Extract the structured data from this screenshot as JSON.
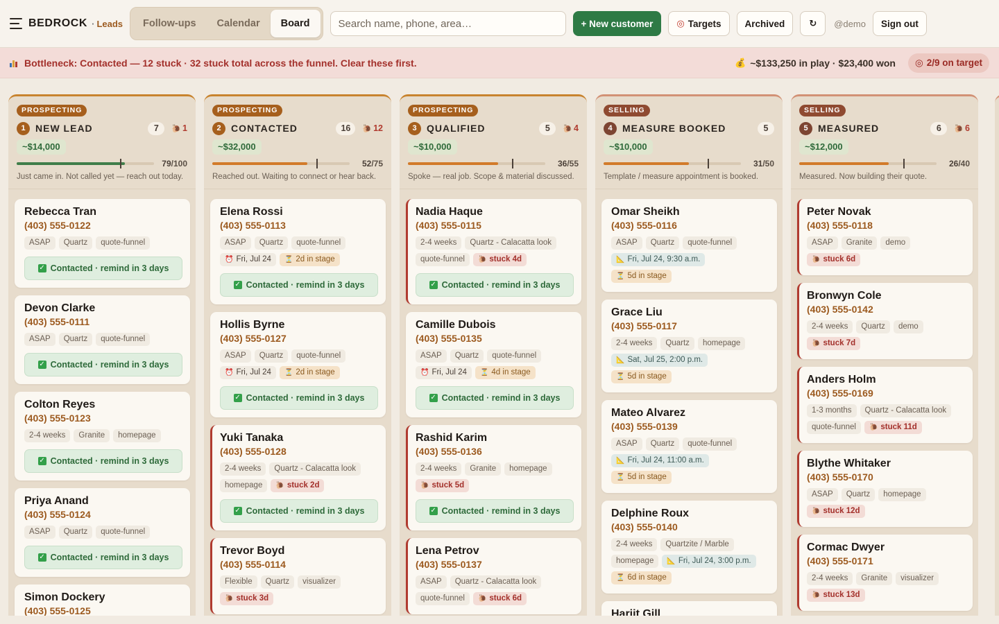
{
  "app": {
    "brand": "BEDROCK",
    "section": "Leads",
    "dot": "·"
  },
  "nav": {
    "tabs": [
      {
        "label": "Follow-ups"
      },
      {
        "label": "Calendar"
      },
      {
        "label": "Board"
      }
    ],
    "active": "Board"
  },
  "search": {
    "placeholder": "Search name, phone, area…",
    "value": ""
  },
  "actions": {
    "new_customer": "+ New customer",
    "targets": "Targets",
    "archived": "Archived",
    "refresh": "↻",
    "user": "@demo",
    "signout": "Sign out"
  },
  "alert": {
    "label": "Bottleneck:",
    "stage": "Contacted",
    "text": "— 12 stuck · 32 stuck total across the funnel. Clear these first.",
    "in_play": "~$133,250 in play · $23,400 won",
    "on_target": "2/9 on target"
  },
  "colors": {
    "accent": "#2e7a45",
    "stuck": "#b03b2f",
    "prospect": "#a65f1d",
    "selling": "#8f4a31"
  },
  "columns": [
    {
      "group": "PROSPECTING",
      "number": "1",
      "title": "NEW LEAD",
      "count": "7",
      "stuck": "1",
      "value": "~$14,000",
      "progress": "79",
      "target": "/100",
      "progress_fraction": 0.79,
      "target_mark": 0.75,
      "bar": "green",
      "desc": "Just came in. Not called yet — reach out today.",
      "cards": [
        {
          "name": "Rebecca Tran",
          "phone": "(403) 555-0122",
          "tags": [
            "ASAP",
            "Quartz",
            "quote-funnel"
          ],
          "action": "Contacted · remind in 3 days"
        },
        {
          "name": "Devon Clarke",
          "phone": "(403) 555-0111",
          "tags": [
            "ASAP",
            "Quartz",
            "quote-funnel"
          ],
          "action": "Contacted · remind in 3 days"
        },
        {
          "name": "Colton Reyes",
          "phone": "(403) 555-0123",
          "tags": [
            "2-4 weeks",
            "Granite",
            "homepage"
          ],
          "action": "Contacted · remind in 3 days"
        },
        {
          "name": "Priya Anand",
          "phone": "(403) 555-0124",
          "tags": [
            "ASAP",
            "Quartz",
            "quote-funnel"
          ],
          "action": "Contacted · remind in 3 days"
        },
        {
          "name": "Simon Dockery",
          "phone": "(403) 555-0125",
          "tags": []
        }
      ]
    },
    {
      "group": "PROSPECTING",
      "number": "2",
      "title": "CONTACTED",
      "count": "16",
      "stuck": "12",
      "value": "~$32,000",
      "progress": "52",
      "target": "/75",
      "progress_fraction": 0.693,
      "target_mark": 0.76,
      "bar": "orange",
      "desc": "Reached out. Waiting to connect or hear back.",
      "cards": [
        {
          "name": "Elena Rossi",
          "phone": "(403) 555-0113",
          "tags": [
            "ASAP",
            "Quartz",
            "quote-funnel"
          ],
          "due": "Fri, Jul 24",
          "instage": "2d in stage",
          "action": "Contacted · remind in 3 days"
        },
        {
          "name": "Hollis Byrne",
          "phone": "(403) 555-0127",
          "tags": [
            "ASAP",
            "Quartz",
            "quote-funnel"
          ],
          "due": "Fri, Jul 24",
          "instage": "2d in stage",
          "action": "Contacted · remind in 3 days"
        },
        {
          "name": "Yuki Tanaka",
          "phone": "(403) 555-0128",
          "tags": [
            "2-4 weeks",
            "Quartz - Calacatta look",
            "homepage"
          ],
          "stuck": "stuck 2d",
          "action": "Contacted · remind in 3 days"
        },
        {
          "name": "Trevor Boyd",
          "phone": "(403) 555-0114",
          "tags": [
            "Flexible",
            "Quartz",
            "visualizer"
          ],
          "stuck": "stuck 3d"
        }
      ]
    },
    {
      "group": "PROSPECTING",
      "number": "3",
      "title": "QUALIFIED",
      "count": "5",
      "stuck": "4",
      "value": "~$10,000",
      "progress": "36",
      "target": "/55",
      "progress_fraction": 0.655,
      "target_mark": 0.76,
      "bar": "orange",
      "desc": "Spoke — real job. Scope & material discussed.",
      "cards": [
        {
          "name": "Nadia Haque",
          "phone": "(403) 555-0115",
          "tags": [
            "2-4 weeks",
            "Quartz - Calacatta look",
            "quote-funnel"
          ],
          "stuck": "stuck 4d",
          "action": "Contacted · remind in 3 days"
        },
        {
          "name": "Camille Dubois",
          "phone": "(403) 555-0135",
          "tags": [
            "ASAP",
            "Quartz",
            "quote-funnel"
          ],
          "due": "Fri, Jul 24",
          "instage": "4d in stage",
          "action": "Contacted · remind in 3 days"
        },
        {
          "name": "Rashid Karim",
          "phone": "(403) 555-0136",
          "tags": [
            "2-4 weeks",
            "Granite",
            "homepage"
          ],
          "stuck": "stuck 5d",
          "action": "Contacted · remind in 3 days"
        },
        {
          "name": "Lena Petrov",
          "phone": "(403) 555-0137",
          "tags": [
            "ASAP",
            "Quartz - Calacatta look",
            "quote-funnel"
          ],
          "stuck": "stuck 6d"
        }
      ]
    },
    {
      "group": "SELLING",
      "number": "4",
      "title": "MEASURE BOOKED",
      "count": "5",
      "stuck": "",
      "value": "~$10,000",
      "progress": "31",
      "target": "/50",
      "progress_fraction": 0.62,
      "target_mark": 0.76,
      "bar": "orange",
      "desc": "Template / measure appointment is booked.",
      "cards": [
        {
          "name": "Omar Sheikh",
          "phone": "(403) 555-0116",
          "tags": [
            "ASAP",
            "Quartz",
            "quote-funnel"
          ],
          "appt": "Fri, Jul 24, 9:30 a.m.",
          "instage": "5d in stage"
        },
        {
          "name": "Grace Liu",
          "phone": "(403) 555-0117",
          "tags": [
            "2-4 weeks",
            "Quartz",
            "homepage"
          ],
          "appt": "Sat, Jul 25, 2:00 p.m.",
          "instage": "5d in stage"
        },
        {
          "name": "Mateo Alvarez",
          "phone": "(403) 555-0139",
          "tags": [
            "ASAP",
            "Quartz",
            "quote-funnel"
          ],
          "appt": "Fri, Jul 24, 11:00 a.m.",
          "instage": "5d in stage"
        },
        {
          "name": "Delphine Roux",
          "phone": "(403) 555-0140",
          "tags": [
            "2-4 weeks",
            "Quartzite / Marble",
            "homepage"
          ],
          "appt": "Fri, Jul 24, 3:00 p.m.",
          "instage": "6d in stage"
        },
        {
          "name": "Harjit Gill",
          "phone": "",
          "tags": []
        }
      ]
    },
    {
      "group": "SELLING",
      "number": "5",
      "title": "MEASURED",
      "count": "6",
      "stuck": "6",
      "value": "~$12,000",
      "progress": "26",
      "target": "/40",
      "progress_fraction": 0.65,
      "target_mark": 0.76,
      "bar": "orange",
      "desc": "Measured. Now building their quote.",
      "cards": [
        {
          "name": "Peter Novak",
          "phone": "(403) 555-0118",
          "tags": [
            "ASAP",
            "Granite",
            "demo"
          ],
          "stuck": "stuck 6d"
        },
        {
          "name": "Bronwyn Cole",
          "phone": "(403) 555-0142",
          "tags": [
            "2-4 weeks",
            "Quartz",
            "demo"
          ],
          "stuck": "stuck 7d"
        },
        {
          "name": "Anders Holm",
          "phone": "(403) 555-0169",
          "tags": [
            "1-3 months",
            "Quartz - Calacatta look",
            "quote-funnel"
          ],
          "stuck": "stuck 11d"
        },
        {
          "name": "Blythe Whitaker",
          "phone": "(403) 555-0170",
          "tags": [
            "ASAP",
            "Quartz",
            "homepage"
          ],
          "stuck": "stuck 12d"
        },
        {
          "name": "Cormac Dwyer",
          "phone": "(403) 555-0171",
          "tags": [
            "2-4 weeks",
            "Granite",
            "visualizer"
          ],
          "stuck": "stuck 13d"
        }
      ]
    }
  ]
}
